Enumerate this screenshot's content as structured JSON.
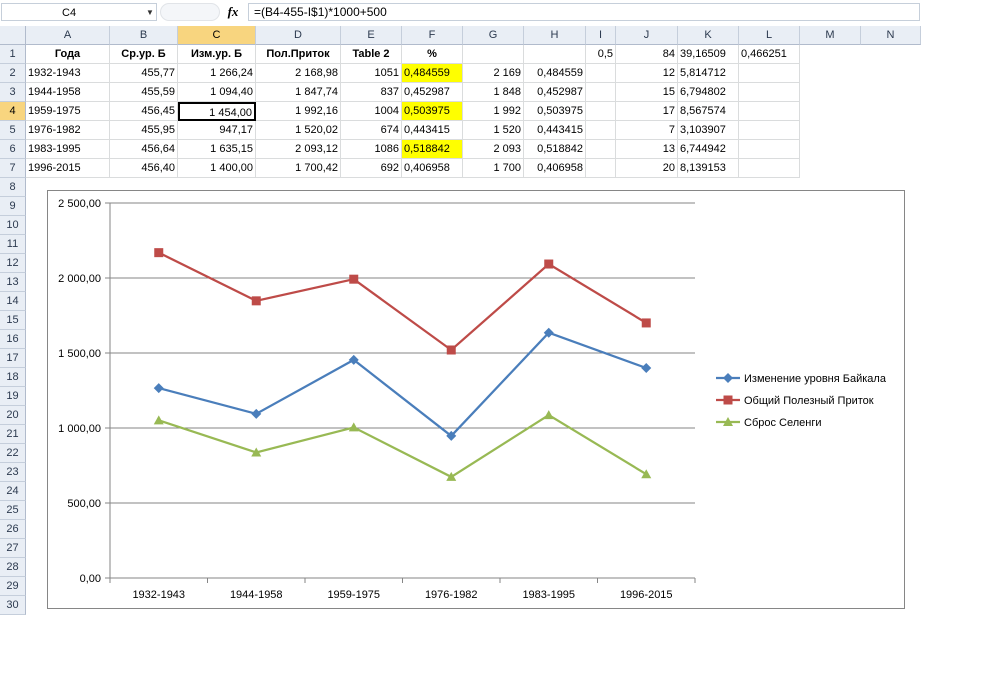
{
  "formula_bar": {
    "name_box": "C4",
    "fx": "fx",
    "formula": "=(B4-455-I$1)*1000+500"
  },
  "columns": [
    "A",
    "B",
    "C",
    "D",
    "E",
    "F",
    "G",
    "H",
    "I",
    "J",
    "K",
    "L",
    "M",
    "N"
  ],
  "selected_column": "C",
  "rows": [
    "1",
    "2",
    "3",
    "4",
    "5",
    "6",
    "7",
    "8",
    "9",
    "10",
    "11",
    "12",
    "13",
    "14",
    "15",
    "16",
    "17",
    "18",
    "19",
    "20",
    "21",
    "22",
    "23",
    "24",
    "25",
    "26",
    "27",
    "28",
    "29",
    "30"
  ],
  "selected_row": "4",
  "cells": {
    "r1": {
      "A": "Года",
      "B": "Ср.ур. Б",
      "C": "Изм.ур. Б",
      "D": "Пол.Приток",
      "E": "Table 2",
      "F": "%",
      "G": "",
      "H": "",
      "I": "0,5",
      "J": "84",
      "K": "39,16509",
      "L": "0,466251"
    },
    "r2": {
      "A": "1932-1943",
      "B": "455,77",
      "C": "1 266,24",
      "D": "2 168,98",
      "E": "1051",
      "F": "0,484559",
      "G": "2 169",
      "H": "0,484559",
      "I": "",
      "J": "12",
      "K": "5,814712",
      "L": ""
    },
    "r3": {
      "A": "1944-1958",
      "B": "455,59",
      "C": "1 094,40",
      "D": "1 847,74",
      "E": "837",
      "F": "0,452987",
      "G": "1 848",
      "H": "0,452987",
      "I": "",
      "J": "15",
      "K": "6,794802",
      "L": ""
    },
    "r4": {
      "A": "1959-1975",
      "B": "456,45",
      "C": "1 454,00",
      "D": "1 992,16",
      "E": "1004",
      "F": "0,503975",
      "G": "1 992",
      "H": "0,503975",
      "I": "",
      "J": "17",
      "K": "8,567574",
      "L": ""
    },
    "r5": {
      "A": "1976-1982",
      "B": "455,95",
      "C": "947,17",
      "D": "1 520,02",
      "E": "674",
      "F": "0,443415",
      "G": "1 520",
      "H": "0,443415",
      "I": "",
      "J": "7",
      "K": "3,103907",
      "L": ""
    },
    "r6": {
      "A": "1983-1995",
      "B": "456,64",
      "C": "1 635,15",
      "D": "2 093,12",
      "E": "1086",
      "F": "0,518842",
      "G": "2 093",
      "H": "0,518842",
      "I": "",
      "J": "13",
      "K": "6,744942",
      "L": ""
    },
    "r7": {
      "A": "1996-2015",
      "B": "456,40",
      "C": "1 400,00",
      "D": "1 700,42",
      "E": "692",
      "F": "0,406958",
      "G": "1 700",
      "H": "0,406958",
      "I": "",
      "J": "20",
      "K": "8,139153",
      "L": ""
    }
  },
  "highlight_color": "#ffff00",
  "chart_data": {
    "type": "line",
    "categories": [
      "1932-1943",
      "1944-1958",
      "1959-1975",
      "1976-1982",
      "1983-1995",
      "1996-2015"
    ],
    "series": [
      {
        "name": "Изменение уровня Байкала",
        "values": [
          1266.24,
          1094.4,
          1454.0,
          947.17,
          1635.15,
          1400.0
        ],
        "color": "#4a7ebb",
        "marker": "diamond"
      },
      {
        "name": "Общий Полезный Приток",
        "values": [
          2168.98,
          1847.74,
          1992.16,
          1520.02,
          2093.12,
          1700.42
        ],
        "color": "#be4b48",
        "marker": "square"
      },
      {
        "name": "Сброс Селенги",
        "values": [
          1051,
          837,
          1004,
          674,
          1086,
          692
        ],
        "color": "#98b954",
        "marker": "triangle"
      }
    ],
    "ylim": [
      0,
      2500
    ],
    "yticks": [
      "0,00",
      "500,00",
      "1 000,00",
      "1 500,00",
      "2 000,00",
      "2 500,00"
    ],
    "ytick_values": [
      0,
      500,
      1000,
      1500,
      2000,
      2500
    ],
    "grid": true,
    "legend_position": "right"
  }
}
